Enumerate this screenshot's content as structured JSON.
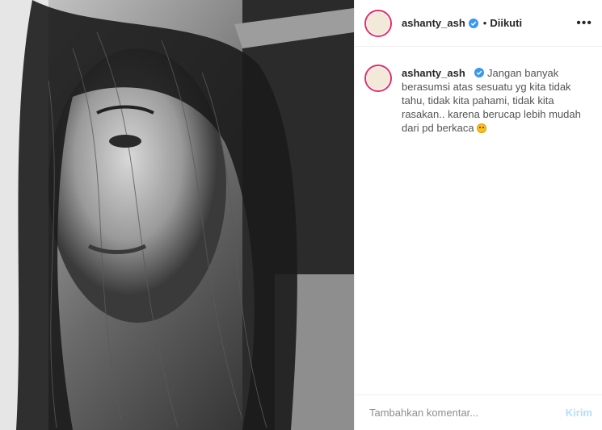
{
  "post": {
    "username": "ashanty_ash",
    "follow_status": "Diikuti",
    "separator": "•",
    "more_icon": "more-horizontal-icon",
    "verified_icon": "verified-badge-icon",
    "accent_ring": "#e1306c",
    "verified_color": "#3897f0"
  },
  "caption": {
    "username": "ashanty_ash",
    "text": "Jangan banyak berasumsi atas sesuatu yg kita tidak tahu, tidak kita pahami, tidak kita rasakan.. karena berucap lebih mudah dari pd berkaca",
    "emoji": "heart-eyes-emoji"
  },
  "comment": {
    "placeholder": "Tambahkan komentar...",
    "post_label": "Kirim"
  }
}
